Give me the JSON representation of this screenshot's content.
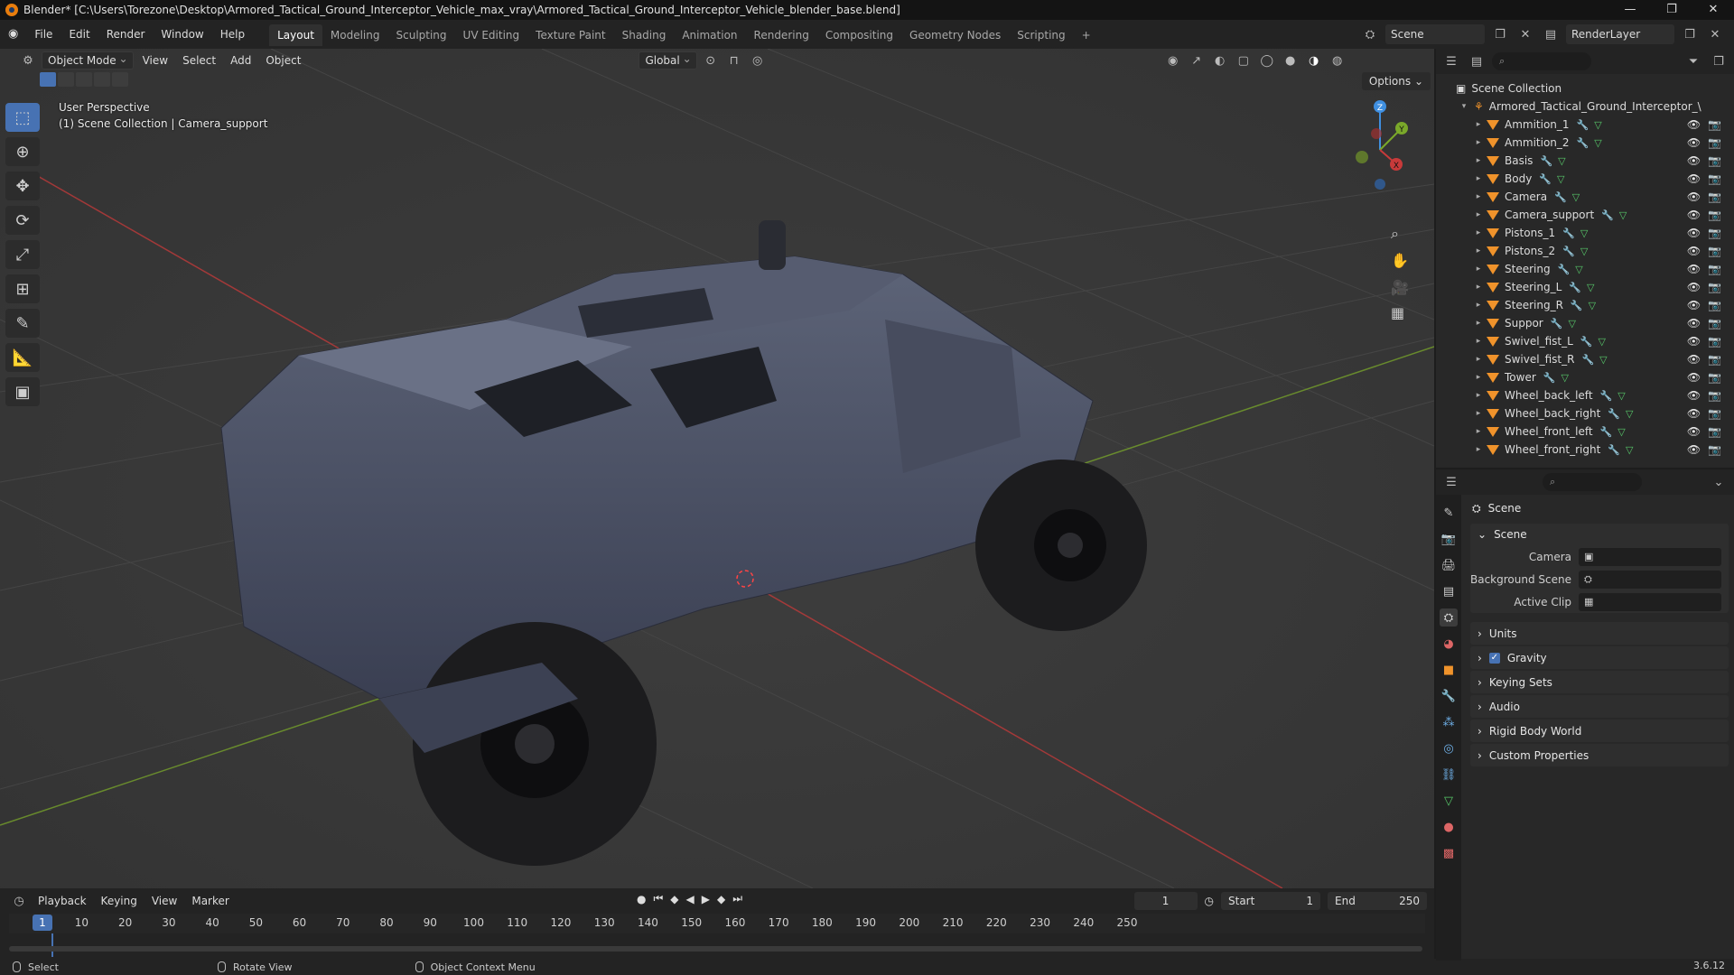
{
  "window": {
    "title": "Blender* [C:\\Users\\Torezone\\Desktop\\Armored_Tactical_Ground_Interceptor_Vehicle_max_vray\\Armored_Tactical_Ground_Interceptor_Vehicle_blender_base.blend]",
    "minimize": "—",
    "maximize": "❐",
    "close": "✕"
  },
  "menu": {
    "items": [
      "File",
      "Edit",
      "Render",
      "Window",
      "Help"
    ]
  },
  "workspaces": {
    "active": "Layout",
    "tabs": [
      "Layout",
      "Modeling",
      "Sculpting",
      "UV Editing",
      "Texture Paint",
      "Shading",
      "Animation",
      "Rendering",
      "Compositing",
      "Geometry Nodes",
      "Scripting"
    ],
    "add": "+"
  },
  "top_right": {
    "scene": "Scene",
    "view_layer": "RenderLayer"
  },
  "viewport": {
    "mode": "Object Mode",
    "menus": [
      "View",
      "Select",
      "Add",
      "Object"
    ],
    "orientation": "Global",
    "options": "Options",
    "perspective": "User Perspective",
    "context": "(1) Scene Collection | Camera_support",
    "gizmo": {
      "x": "X",
      "y": "Y",
      "z": "Z"
    }
  },
  "timeline": {
    "menus": [
      "Playback",
      "Keying",
      "View",
      "Marker"
    ],
    "current_frame": "1",
    "start_label": "Start",
    "start": "1",
    "end_label": "End",
    "end": "250",
    "ticks": [
      "1",
      "10",
      "20",
      "30",
      "40",
      "50",
      "60",
      "70",
      "80",
      "90",
      "100",
      "110",
      "120",
      "130",
      "140",
      "150",
      "160",
      "170",
      "180",
      "190",
      "200",
      "210",
      "220",
      "230",
      "240",
      "250"
    ]
  },
  "status": {
    "select": "Select",
    "rotate": "Rotate View",
    "context_menu": "Object Context Menu",
    "version": "3.6.12"
  },
  "outliner": {
    "root": "Scene Collection",
    "collection": "Armored_Tactical_Ground_Interceptor_\\",
    "objects": [
      "Ammition_1",
      "Ammition_2",
      "Basis",
      "Body",
      "Camera",
      "Camera_support",
      "Pistons_1",
      "Pistons_2",
      "Steering",
      "Steering_L",
      "Steering_R",
      "Suppor",
      "Swivel_fist_L",
      "Swivel_fist_R",
      "Tower",
      "Wheel_back_left",
      "Wheel_back_right",
      "Wheel_front_left",
      "Wheel_front_right"
    ],
    "selected": "Camera_support"
  },
  "properties": {
    "context": "Scene",
    "panel": "Scene",
    "fields": {
      "camera": "Camera",
      "background_scene": "Background Scene",
      "active_clip": "Active Clip"
    },
    "sections": [
      "Units",
      "Gravity",
      "Keying Sets",
      "Audio",
      "Rigid Body World",
      "Custom Properties"
    ]
  },
  "colors": {
    "accent": "#4772b3",
    "object_icon": "#f0932b",
    "viewport_bg": "#393939",
    "x_axis": "#c83a3a",
    "y_axis": "#7aa82a"
  }
}
